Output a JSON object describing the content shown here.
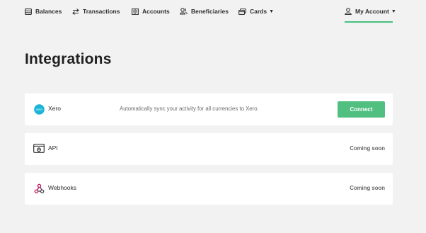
{
  "nav": {
    "items": [
      {
        "label": "Balances",
        "icon": "wallet-icon"
      },
      {
        "label": "Transactions",
        "icon": "transfer-arrows-icon"
      },
      {
        "label": "Accounts",
        "icon": "ledger-icon"
      },
      {
        "label": "Beneficiaries",
        "icon": "people-icon"
      },
      {
        "label": "Cards",
        "icon": "cards-icon",
        "has_dropdown": true
      }
    ],
    "account": {
      "label": "My Account",
      "icon": "user-icon",
      "has_dropdown": true
    },
    "accent_color": "#48bf7f"
  },
  "page": {
    "title": "Integrations"
  },
  "integrations": [
    {
      "name": "Xero",
      "icon": "xero-logo-icon",
      "description": "Automatically sync your activity for all currencies to Xero.",
      "action_label": "Connect"
    },
    {
      "name": "API",
      "icon": "api-window-icon",
      "status": "Coming soon"
    },
    {
      "name": "Webhooks",
      "icon": "webhooks-icon",
      "status": "Coming soon"
    }
  ],
  "logo_text": "xero",
  "colors": {
    "button": "#50bf7f",
    "xero_brand": "#1ab4d7",
    "webhook": "#c2185b"
  }
}
